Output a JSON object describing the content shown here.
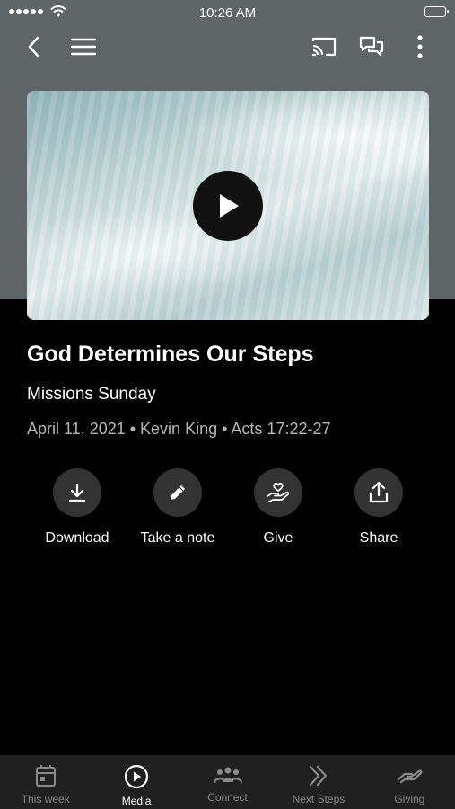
{
  "status_bar": {
    "time": "10:26 AM"
  },
  "nav": {
    "back_icon": "chevron-left-icon",
    "menu_icon": "hamburger-icon",
    "cast_icon": "cast-icon",
    "chat_icon": "chat-icon",
    "more_icon": "more-vertical-icon"
  },
  "video": {
    "play_icon": "play-icon"
  },
  "sermon": {
    "title": "God Determines Our Steps",
    "series": "Missions Sunday",
    "meta": "April 11, 2021 • Kevin King • Acts 17:22-27"
  },
  "actions": [
    {
      "label": "Download",
      "icon": "download-icon"
    },
    {
      "label": "Take a note",
      "icon": "pencil-icon"
    },
    {
      "label": "Give",
      "icon": "give-heart-hand-icon"
    },
    {
      "label": "Share",
      "icon": "share-icon"
    }
  ],
  "tabs": [
    {
      "label": "This week",
      "icon": "calendar-icon",
      "active": false
    },
    {
      "label": "Media",
      "icon": "play-circle-icon",
      "active": true
    },
    {
      "label": "Connect",
      "icon": "people-icon",
      "active": false
    },
    {
      "label": "Next Steps",
      "icon": "double-chevron-right-icon",
      "active": false
    },
    {
      "label": "Giving",
      "icon": "giving-hand-icon",
      "active": false
    }
  ],
  "colors": {
    "background": "#000000",
    "header": "#5f6466",
    "tabbar": "#202020",
    "action_circle": "#333333",
    "muted_text": "#b5b5b5"
  }
}
